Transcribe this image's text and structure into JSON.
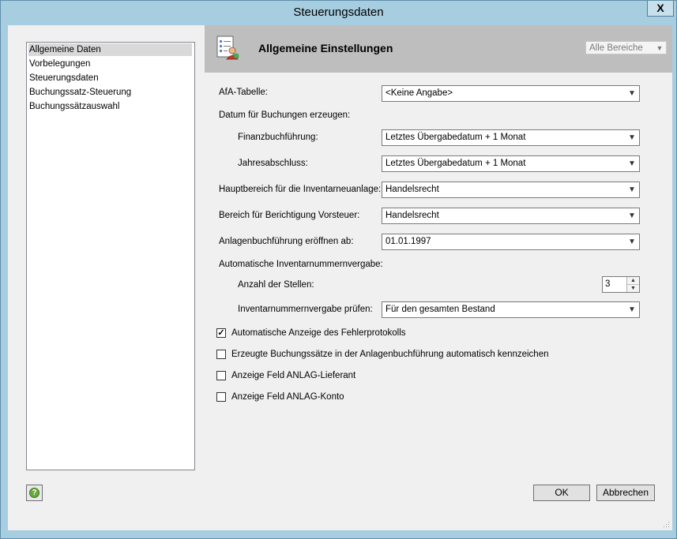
{
  "window": {
    "title": "Steuerungsdaten",
    "close_label": "X"
  },
  "nav": {
    "items": [
      {
        "label": "Allgemeine Daten",
        "selected": true
      },
      {
        "label": "Vorbelegungen",
        "selected": false
      },
      {
        "label": "Steuerungsdaten",
        "selected": false
      },
      {
        "label": "Buchungssatz-Steuerung",
        "selected": false
      },
      {
        "label": "Buchungssätzauswahl",
        "selected": false
      }
    ]
  },
  "header": {
    "title": "Allgemeine Einstellungen",
    "icon": "settings-document-icon",
    "area_select": "Alle Bereiche"
  },
  "form": {
    "afa_label": "AfA-Tabelle:",
    "afa_value": "<Keine Angabe>",
    "datum_label": "Datum für Buchungen erzeugen:",
    "finanz_label": "Finanzbuchführung:",
    "finanz_value": "Letztes Übergabedatum + 1 Monat",
    "jahres_label": "Jahresabschluss:",
    "jahres_value": "Letztes Übergabedatum + 1 Monat",
    "haupt_label": "Hauptbereich für die Inventarneuanlage:",
    "haupt_value": "Handelsrecht",
    "vorsteuer_label": "Bereich für Berichtigung Vorsteuer:",
    "vorsteuer_value": "Handelsrecht",
    "anlagen_label": "Anlagenbuchführung eröffnen ab:",
    "anlagen_value": "01.01.1997",
    "auto_label": "Automatische Inventarnummernvergabe:",
    "stellen_label": "Anzahl der Stellen:",
    "stellen_value": "3",
    "pruefen_label": "Inventarnummernvergabe prüfen:",
    "pruefen_value": "Für den gesamten Bestand"
  },
  "checks": [
    {
      "label": "Automatische Anzeige des Fehlerprotokolls",
      "checked": true
    },
    {
      "label": "Erzeugte Buchungssätze in der Anlagenbuchführung automatisch kennzeichen",
      "checked": false
    },
    {
      "label": "Anzeige Feld ANLAG-Lieferant",
      "checked": false
    },
    {
      "label": "Anzeige Feld ANLAG-Konto",
      "checked": false
    }
  ],
  "footer": {
    "help_label": "?",
    "ok_label": "OK",
    "cancel_label": "Abbrechen"
  },
  "colors": {
    "window_frame": "#a7cde0",
    "header_band": "#bebebe",
    "help_green": "#67a83a"
  }
}
